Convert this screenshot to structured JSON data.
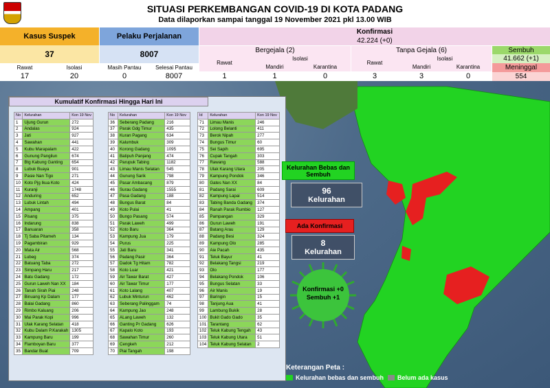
{
  "header": {
    "title": "SITUASI PERKEMBANGAN COVID-19 DI KOTA PADANG",
    "subtitle": "Data dilaporkan sampai tanggal 19 November 2021 pkl 13.00 WIB"
  },
  "stats": {
    "suspek_label": "Kasus Suspek",
    "suspek_value": "37",
    "rawat_label": "Rawat",
    "rawat_value": "17",
    "isolasi_label": "Isolasi",
    "isolasi_value": "20",
    "perjalanan_label": "Pelaku Perjalanan",
    "perjalanan_value": "8007",
    "masih_label": "Masih Pantau",
    "masih_value": "0",
    "selesai_label": "Selesai Pantau",
    "selesai_value": "8007",
    "konfirmasi_label": "Konfirmasi",
    "konfirmasi_value": "42.224 (+0)",
    "bergejala_label": "Bergejala (2)",
    "bg_rawat_label": "Rawat",
    "bg_rawat_value": "1",
    "bg_isolasi_label": "Isolasi",
    "bg_mandiri_label": "Mandiri",
    "bg_mandiri_value": "1",
    "bg_karantina_label": "Karantina",
    "bg_karantina_value": "0",
    "tanpa_label": "Tanpa Gejala (6)",
    "tg_rawat_label": "Rawat",
    "tg_rawat_value": "3",
    "tg_isolasi_label": "Isolasi",
    "tg_mandiri_label": "Mandiri",
    "tg_mandiri_value": "3",
    "tg_karantina_label": "Karantina",
    "tg_karantina_value": "0",
    "sembuh_label": "Sembuh",
    "sembuh_value": "41.662 (+1)",
    "meninggal_label": "Meninggal",
    "meninggal_value": "554"
  },
  "panel_title": "Kumulatif Konfirmasi Hingga Hari Ini",
  "columns": [
    {
      "h_no": "No",
      "h_kel": "Kelurahan",
      "h_val": "Kon 19 Nov",
      "rows": [
        [
          "1",
          "Ujung Gurun",
          "272"
        ],
        [
          "2",
          "Andalas",
          "924"
        ],
        [
          "3",
          "Jati",
          "927"
        ],
        [
          "4",
          "Sawahan",
          "441"
        ],
        [
          "5",
          "Kubu Marapalam",
          "422"
        ],
        [
          "6",
          "Gunung Pangilun",
          "674"
        ],
        [
          "7",
          "Btg Kabung Ganting",
          "654"
        ],
        [
          "8",
          "Lubuk Buaya",
          "901"
        ],
        [
          "9",
          "Pasie Nan Tigo",
          "271"
        ],
        [
          "10",
          "Koto Pjg Ikua Koto",
          "424"
        ],
        [
          "11",
          "Kuranji",
          "1748"
        ],
        [
          "12",
          "Anduring",
          "652"
        ],
        [
          "13",
          "Lubuk Lintah",
          "494"
        ],
        [
          "14",
          "Ampang",
          "401"
        ],
        [
          "15",
          "Pisang",
          "375"
        ],
        [
          "16",
          "Indarung",
          "838"
        ],
        [
          "17",
          "Banuaran",
          "358"
        ],
        [
          "18",
          "Tj Saba Pitameh",
          "134"
        ],
        [
          "19",
          "Pagambiran",
          "929"
        ],
        [
          "20",
          "Mata Air",
          "568"
        ],
        [
          "21",
          "Lubeg",
          "374"
        ],
        [
          "22",
          "Batuang Taba",
          "272"
        ],
        [
          "23",
          "Simpang Haru",
          "217"
        ],
        [
          "24",
          "Batu Gadang",
          "172"
        ],
        [
          "25",
          "Gurun Laweh Nan XX",
          "184"
        ],
        [
          "26",
          "Tanah Sirah Piai",
          "248"
        ],
        [
          "27",
          "Binuang Kp Dalam",
          "177"
        ],
        [
          "28",
          "Balai Gadang",
          "860"
        ],
        [
          "29",
          "Rimbo Kaluang",
          "206"
        ],
        [
          "30",
          "Mai Parak Kopi",
          "996"
        ],
        [
          "31",
          "Ulak Karang Selatan",
          "418"
        ],
        [
          "32",
          "Kubu Dalam P.Karakah",
          "1305"
        ],
        [
          "33",
          "Kampung Baru",
          "199"
        ],
        [
          "34",
          "Flamboyan Baru",
          "377"
        ],
        [
          "35",
          "Bandar Buat",
          "709"
        ]
      ]
    },
    {
      "h_no": "No",
      "h_kel": "Kelurahan",
      "h_val": "Kon 19 Nov",
      "rows": [
        [
          "36",
          "Seberang Padang",
          "216"
        ],
        [
          "37",
          "Parak Gdg Timur",
          "435"
        ],
        [
          "38",
          "Kuran Pagang",
          "634"
        ],
        [
          "39",
          "Kalumbuk",
          "309"
        ],
        [
          "40",
          "Korong Gadang",
          "1095"
        ],
        [
          "41",
          "Batipuh Panjang",
          "474"
        ],
        [
          "42",
          "Parupuk Tabing",
          "1182"
        ],
        [
          "43",
          "Limau Manis Selatan",
          "545"
        ],
        [
          "44",
          "Gunung Sarik",
          "798"
        ],
        [
          "45",
          "Pasar Ambacang",
          "879"
        ],
        [
          "46",
          "Surau Gadang",
          "1555"
        ],
        [
          "47",
          "Pasa Gadang",
          "188"
        ],
        [
          "48",
          "Bungus Barat",
          "84"
        ],
        [
          "49",
          "Koto Pulai",
          "41"
        ],
        [
          "50",
          "Bungo Pasang",
          "574"
        ],
        [
          "51",
          "Parak Laweh",
          "499"
        ],
        [
          "52",
          "Koto Baru",
          "364"
        ],
        [
          "53",
          "Kampung Jua",
          "179"
        ],
        [
          "54",
          "Purus",
          "225"
        ],
        [
          "55",
          "Jati Baru",
          "341"
        ],
        [
          "56",
          "Padang Pasir",
          "364"
        ],
        [
          "57",
          "Dadok Tg Hitam",
          "782"
        ],
        [
          "58",
          "Koto Luar",
          "421"
        ],
        [
          "59",
          "Air Tawar Barat",
          "427"
        ],
        [
          "60",
          "Air Tawar Timur",
          "177"
        ],
        [
          "61",
          "Koto Lalang",
          "407"
        ],
        [
          "62",
          "Lubuk Minturun",
          "462"
        ],
        [
          "63",
          "Seberang Palinggam",
          "74"
        ],
        [
          "64",
          "Kampung Jao",
          "248"
        ],
        [
          "65",
          "ALang Laweh",
          "132"
        ],
        [
          "66",
          "Ganting Pr Gadang",
          "626"
        ],
        [
          "67",
          "Kapalo Koto",
          "193"
        ],
        [
          "68",
          "Sawahan Timur",
          "260"
        ],
        [
          "69",
          "Cengkeh",
          "212"
        ],
        [
          "70",
          "Piai Tangah",
          "198"
        ]
      ]
    },
    {
      "h_no": "Id",
      "h_kel": "Kelurahan",
      "h_val": "Kon 19 Nov",
      "rows": [
        [
          "71",
          "Limau Manis",
          "246"
        ],
        [
          "72",
          "Lolong Belanti",
          "411"
        ],
        [
          "73",
          "Berok Nipah",
          "277"
        ],
        [
          "74",
          "Bungus Timur",
          "60"
        ],
        [
          "75",
          "Sei Sapih",
          "695"
        ],
        [
          "76",
          "Cupak Tangah",
          "303"
        ],
        [
          "77",
          "Rawang",
          "588"
        ],
        [
          "78",
          "Ulak Karang Utara",
          "205"
        ],
        [
          "79",
          "Kampung Pondok",
          "346"
        ],
        [
          "80",
          "Gates Nan XX",
          "84"
        ],
        [
          "81",
          "Padang Sarai",
          "609"
        ],
        [
          "82",
          "Kampung Lapai",
          "514"
        ],
        [
          "83",
          "Tabing Banda Gadang",
          "374"
        ],
        [
          "84",
          "Ranah Parak Rumbio",
          "127"
        ],
        [
          "85",
          "Pampangan",
          "329"
        ],
        [
          "86",
          "Gurun Laweh",
          "191"
        ],
        [
          "87",
          "Batang Arau",
          "129"
        ],
        [
          "88",
          "Padang Besi",
          "324"
        ],
        [
          "89",
          "Kampung Olo",
          "285"
        ],
        [
          "90",
          "Aie Pacah",
          "435"
        ],
        [
          "91",
          "Teluk Bayur",
          "41"
        ],
        [
          "92",
          "Belakang Tangsi",
          "219"
        ],
        [
          "93",
          "Olo",
          "177"
        ],
        [
          "94",
          "Belakang Pondok",
          "106"
        ],
        [
          "95",
          "Bungus Selatan",
          "33"
        ],
        [
          "96",
          "Air Manis",
          "19"
        ],
        [
          "97",
          "Baringin",
          "15"
        ],
        [
          "98",
          "Tanjung Aua",
          "41"
        ],
        [
          "99",
          "Lambung Bukik",
          "28"
        ],
        [
          "100",
          "Bukit Gado Gado",
          "35"
        ],
        [
          "101",
          "Tarantang",
          "62"
        ],
        [
          "102",
          "Teluk Kabung Tengah",
          "43"
        ],
        [
          "103",
          "Teluk Kabung Utara",
          "51"
        ],
        [
          "104",
          "Teluk Kabung Selatan",
          "2"
        ]
      ]
    }
  ],
  "map": {
    "bebas_label": "Kelurahan Bebas dan Sembuh",
    "bebas_count": "96",
    "bebas_unit": "Kelurahan",
    "konfirmasi_label": "Ada Konfirmasi",
    "konfirmasi_count": "8",
    "konfirmasi_unit": "Kelurahan",
    "virus_line1": "Konfirmasi +0",
    "virus_line2": "Sembuh +1",
    "keterangan_label": "Keterangan Peta :",
    "legend_green": "Kelurahan bebas dan sembuh",
    "legend_grey": "Belum ada kasus",
    "colors": {
      "green": "#22d322",
      "red": "#e62020",
      "grey": "#8a8a8a"
    }
  }
}
